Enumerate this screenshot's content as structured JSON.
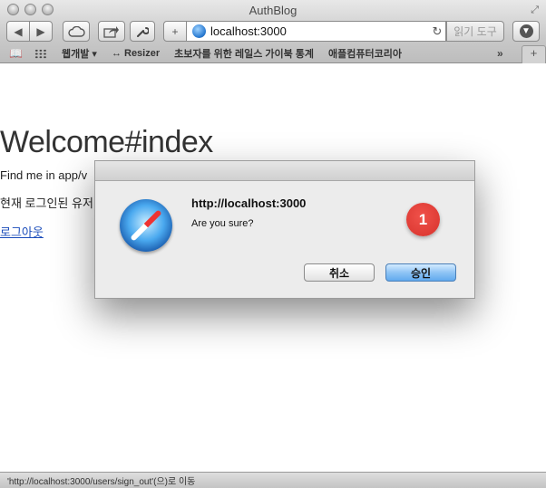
{
  "window": {
    "title": "AuthBlog"
  },
  "toolbar": {
    "back_icon": "back-arrow-icon",
    "forward_icon": "forward-arrow-icon",
    "url": "localhost:3000",
    "reader_label": "읽기 도구"
  },
  "bookmarks": {
    "items": [
      {
        "label": "웹개발 ▾"
      },
      {
        "label": "↔ Resizer"
      },
      {
        "label": "초보자를 위한 레일스 가이북 통계"
      },
      {
        "label": "애플컴퓨터코리아"
      }
    ],
    "more": "»",
    "new_tab": "+"
  },
  "page": {
    "heading": "Welcome#index",
    "line1": "Find me in app/v",
    "line2": "현재 로그인된 유저",
    "logout_link": "로그아웃"
  },
  "dialog": {
    "title": "http://localhost:3000",
    "message": "Are you sure?",
    "badge": "1",
    "cancel_label": "취소",
    "ok_label": "승인"
  },
  "status": {
    "text": "'http://localhost:3000/users/sign_out'(으)로 이동"
  }
}
